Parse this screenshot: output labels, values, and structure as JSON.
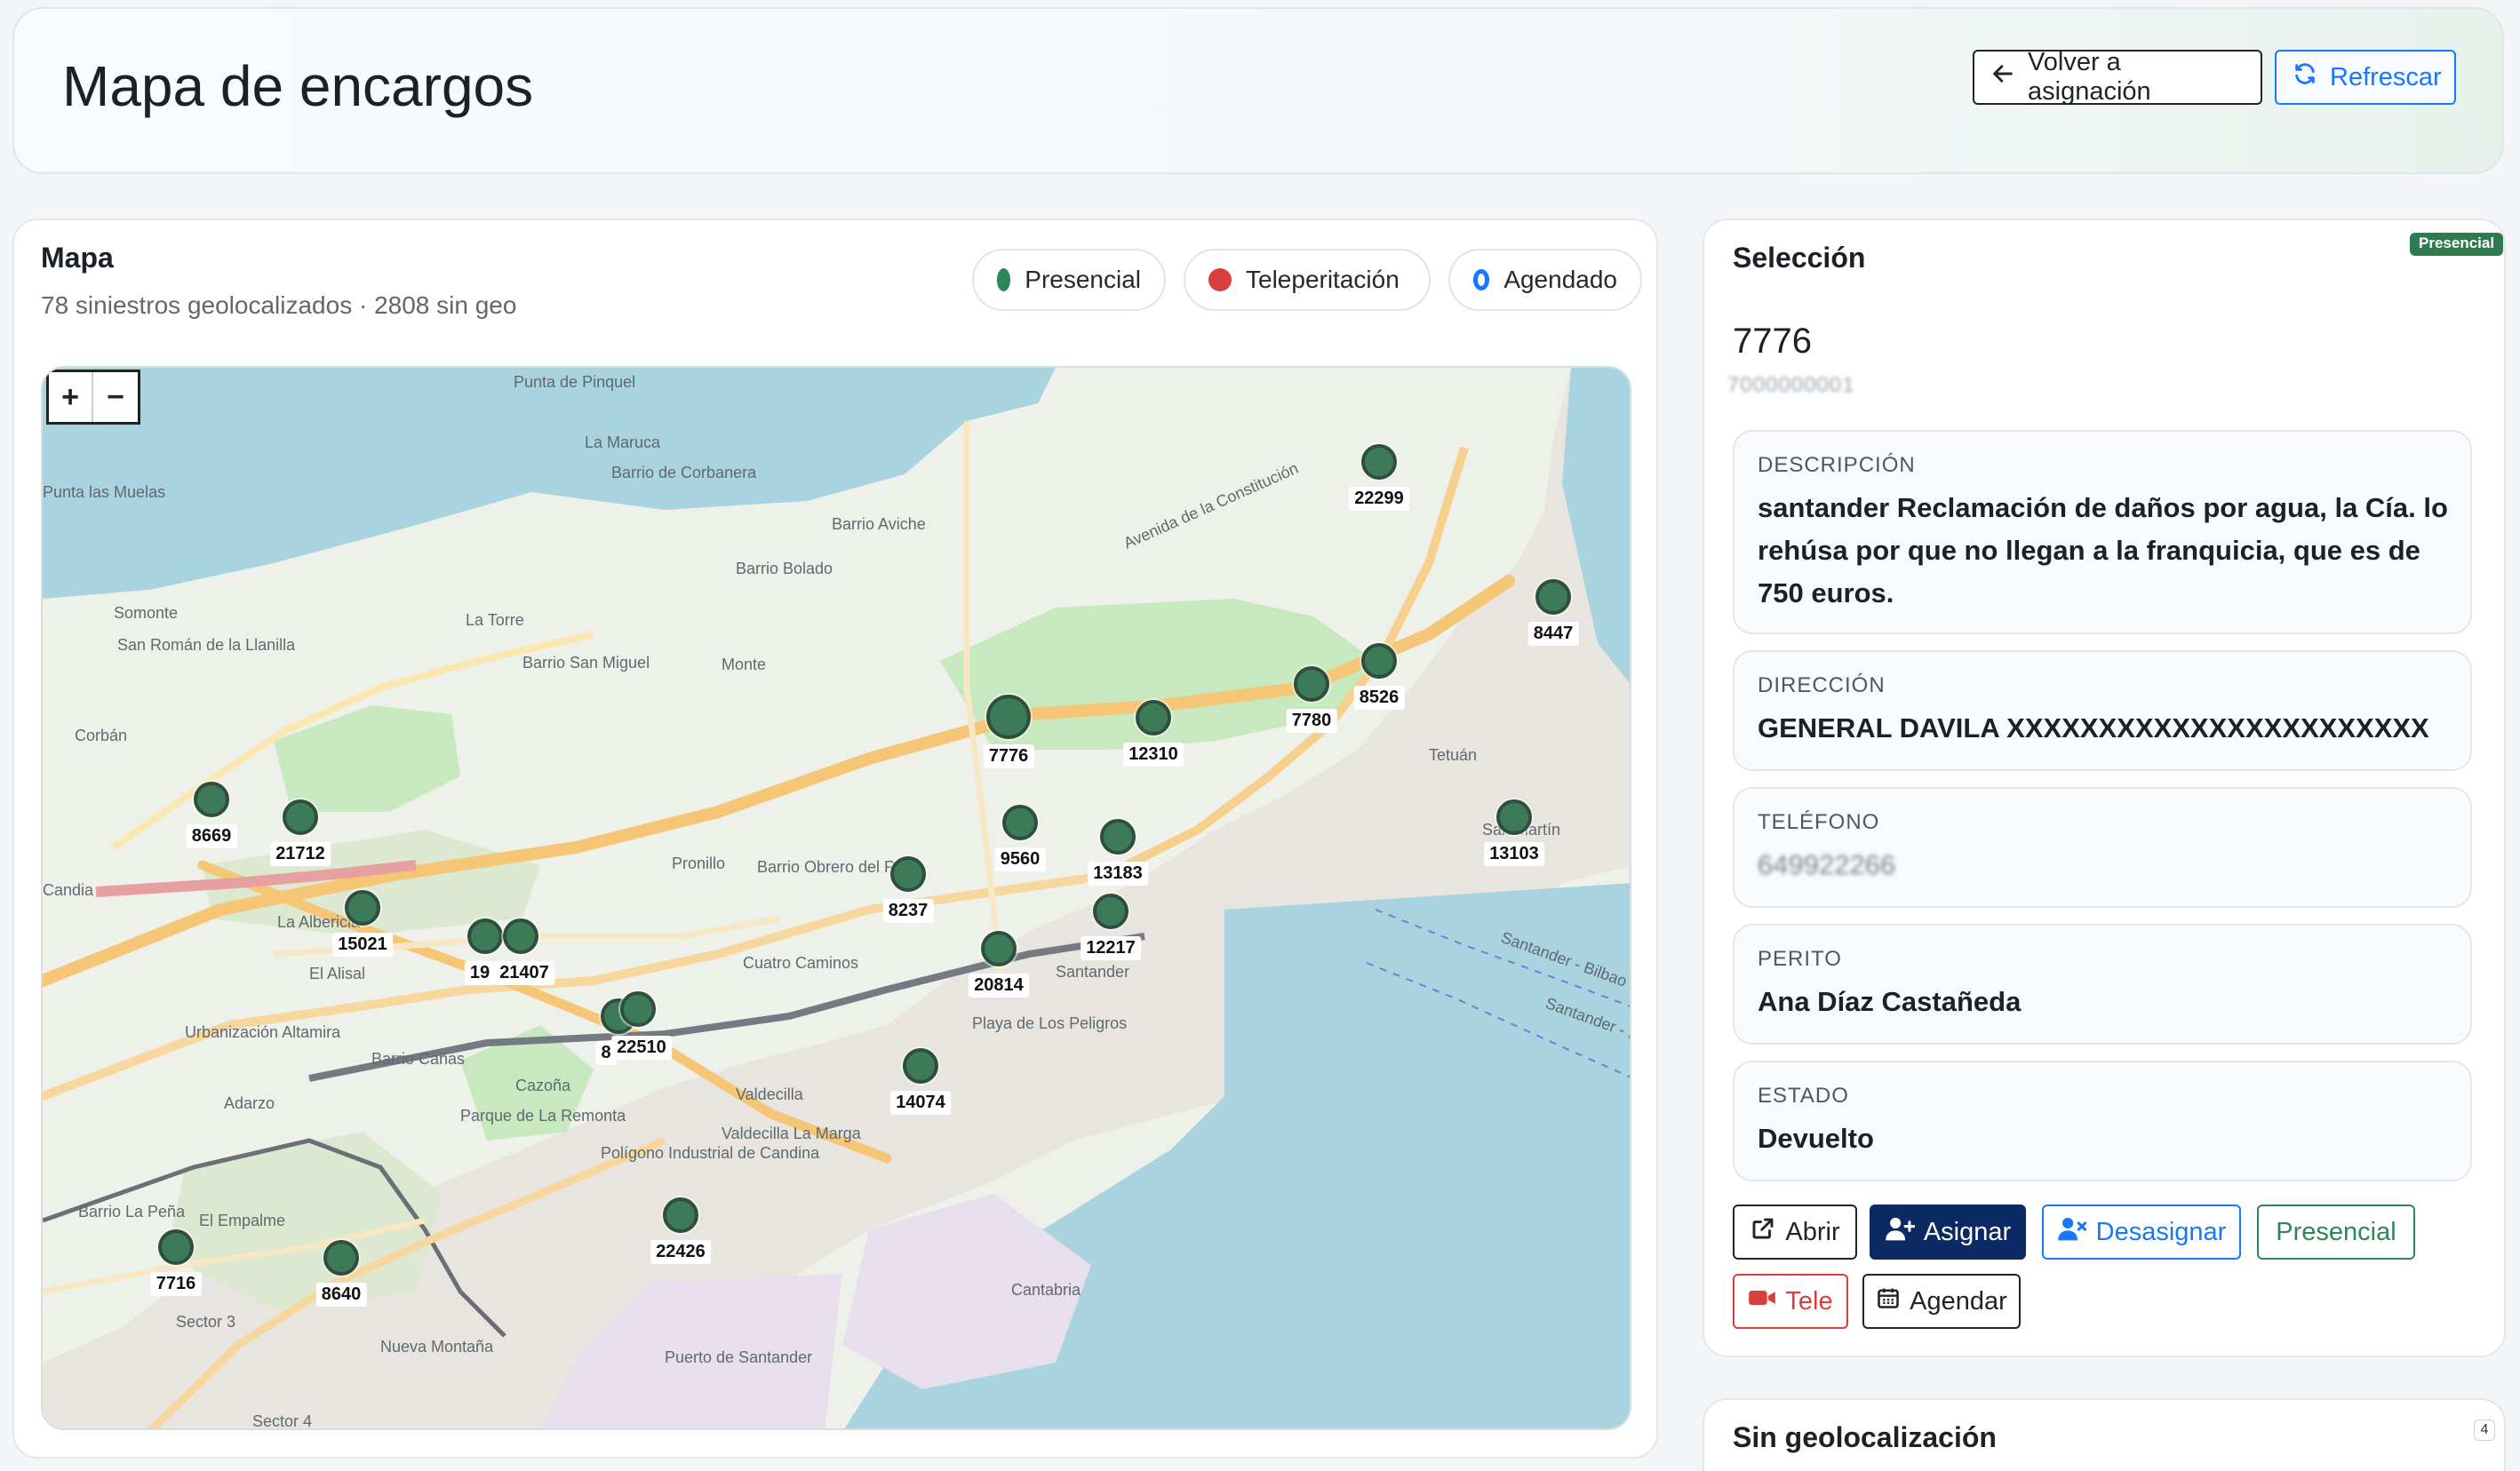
{
  "header": {
    "title": "Mapa de encargos",
    "back_label": "Volver a asignación",
    "refresh_label": "Refrescar"
  },
  "map_card": {
    "title": "Mapa",
    "subtitle": "78 siniestros geolocalizados · 2808 sin geo",
    "legend": [
      {
        "label": "Presencial",
        "color": "#2f8655"
      },
      {
        "label": "Teleperitación",
        "color": "#d93f3f"
      },
      {
        "label": "Agendado",
        "color": "#1677ff"
      }
    ],
    "zoom_in": "+",
    "zoom_out": "−",
    "place_labels": [
      "Punta de Pinquel",
      "La Maruca",
      "Barrio de Corbanera",
      "Punta las Muelas",
      "Barrio Aviche",
      "Barrio Bolado",
      "Somonte",
      "San Román de la Llanilla",
      "La Torre",
      "Barrio San Miguel",
      "Monte",
      "Avenida de la Constitución",
      "Corbán",
      "Tetuán",
      "San Martín",
      "Candia",
      "La Albericia",
      "El Alisal",
      "Pronillo",
      "Barrio Obrero del Rey",
      "Cuatro Caminos",
      "Urbanización Altamira",
      "Barrio Cañas",
      "Adarzo",
      "Cazoña",
      "Parque de La Remonta",
      "Polígono Industrial de Candina",
      "Valdecilla",
      "Valdecilla La Marga",
      "Barrio La Peña",
      "El Empalme",
      "Sector 3",
      "Nueva Montaña",
      "Puerto de Santander",
      "Sector 4",
      "Santander",
      "Santander - Bilbao del Puntal",
      "Santander - Pedreña",
      "Cantabria",
      "Playa de Los Peligros"
    ],
    "markers": [
      "22299",
      "8447",
      "7780",
      "8526",
      "7776",
      "12310",
      "8669",
      "21712",
      "9560",
      "13183",
      "13103",
      "8237",
      "15021",
      "19",
      "21407",
      "12217",
      "20814",
      "8",
      "22510",
      "14074",
      "7716",
      "8640",
      "22426"
    ]
  },
  "selection": {
    "title": "Selección",
    "badge": "Presencial",
    "id": "7776",
    "code": "7000000001",
    "fields": {
      "description_label": "DESCRIPCIÓN",
      "description": "santander Reclamación de daños por agua, la Cía. lo rehúsa por que no llegan a la franquicia, que es de 750 euros.",
      "address_label": "DIRECCIÓN",
      "address": "GENERAL DAVILA XXXXXXXXXXXXXXXXXXXXXXX",
      "phone_label": "TELÉFONO",
      "phone": "649922266",
      "expert_label": "PERITO",
      "expert": "Ana Díaz Castañeda",
      "status_label": "ESTADO",
      "status": "Devuelto"
    },
    "actions": {
      "open": "Abrir",
      "assign": "Asignar",
      "unassign": "Desasignar",
      "presencial": "Presencial",
      "tele": "Tele",
      "schedule": "Agendar"
    }
  },
  "nogeo": {
    "title": "Sin geolocalización",
    "count": "4"
  },
  "colors": {
    "primary": "#1677ff",
    "navy": "#0b2a64",
    "green": "#2f8655",
    "red": "#d93f3f",
    "marker": "#3d7a58"
  }
}
